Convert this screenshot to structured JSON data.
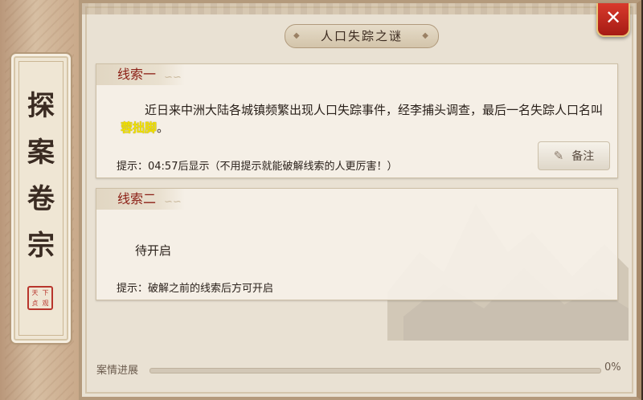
{
  "sidebar": {
    "title_chars": [
      "探",
      "案",
      "卷",
      "宗"
    ],
    "seal_chars": [
      "天",
      "下",
      "贞",
      "观"
    ]
  },
  "header": {
    "title": "人口失踪之谜",
    "close_icon": "close-icon"
  },
  "clues": [
    {
      "label": "线索一",
      "text_before": "近日来中洲大陆各城镇频繁出现人口失踪事件，经李捕头调查，最后一名失踪人口名叫",
      "suspect_name": "蓉拙脚",
      "text_after": "。",
      "hint": "提示：04:57后显示（不用提示就能破解线索的人更厉害！）",
      "note_button": "备注",
      "note_icon": "pencil-icon"
    },
    {
      "label": "线索二",
      "status": "待开启",
      "hint": "提示：破解之前的线索后方可开启"
    }
  ],
  "progress": {
    "label": "案情进展",
    "value_text": "0%",
    "value": 0
  },
  "colors": {
    "clue_label": "#8b1e14",
    "suspect_highlight": "#f0e000",
    "close_button": "#c62a1e"
  }
}
